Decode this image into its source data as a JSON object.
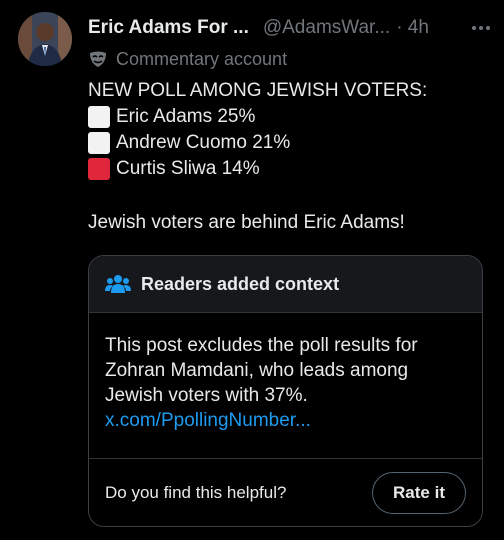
{
  "post": {
    "author_name": "Eric Adams For ...",
    "handle": "@AdamsWar...",
    "time": "· 4h",
    "label": "Commentary account",
    "headline": "NEW POLL AMONG JEWISH VOTERS:",
    "poll": [
      {
        "text": "Eric Adams 25%",
        "color": "#f2f2f2"
      },
      {
        "text": "Andrew Cuomo 21%",
        "color": "#f2f2f2"
      },
      {
        "text": "Curtis Sliwa 14%",
        "color": "#e0263a"
      }
    ],
    "closing": "Jewish voters are behind Eric Adams!"
  },
  "context": {
    "title": "Readers added context",
    "body": "This post excludes the poll results for Zohran Mamdani, who leads among Jewish voters with 37%.",
    "link": "x.com/PpollingNumber...",
    "question": "Do you find this helpful?",
    "rate_label": "Rate it"
  },
  "colors": {
    "accent": "#1d9bf0",
    "muted": "#71767b",
    "text": "#e7e9ea"
  }
}
